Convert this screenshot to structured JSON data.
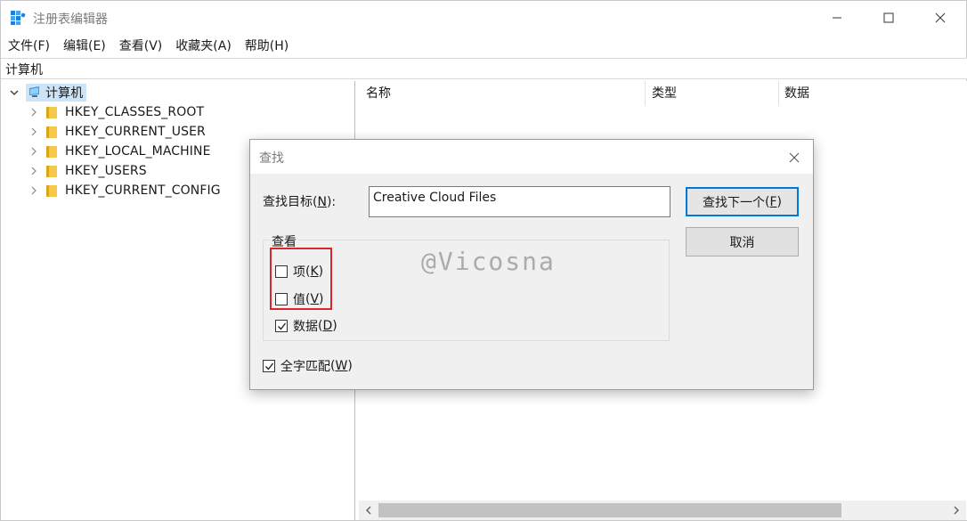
{
  "window": {
    "title": "注册表编辑器",
    "app_icon": "regedit-icon"
  },
  "menu": [
    {
      "label": "文件(F)"
    },
    {
      "label": "编辑(E)"
    },
    {
      "label": "查看(V)"
    },
    {
      "label": "收藏夹(A)"
    },
    {
      "label": "帮助(H)"
    }
  ],
  "address": {
    "path": "计算机"
  },
  "tree": {
    "root": {
      "label": "计算机",
      "icon": "computer-icon"
    },
    "hives": [
      {
        "label": "HKEY_CLASSES_ROOT"
      },
      {
        "label": "HKEY_CURRENT_USER"
      },
      {
        "label": "HKEY_LOCAL_MACHINE"
      },
      {
        "label": "HKEY_USERS"
      },
      {
        "label": "HKEY_CURRENT_CONFIG"
      }
    ]
  },
  "list": {
    "columns": [
      {
        "label": "名称"
      },
      {
        "label": "类型"
      },
      {
        "label": "数据"
      }
    ]
  },
  "find_dialog": {
    "title": "查找",
    "target_label": "查找目标",
    "target_hotkey": "N",
    "target_value": "Creative Cloud Files",
    "find_next_label": "查找下一个",
    "find_next_hotkey": "F",
    "cancel_label": "取消",
    "look_at_label": "查看",
    "options": [
      {
        "label": "项",
        "hotkey": "K",
        "checked": false
      },
      {
        "label": "值",
        "hotkey": "V",
        "checked": false
      },
      {
        "label": "数据",
        "hotkey": "D",
        "checked": true
      }
    ],
    "match_whole": {
      "label": "全字匹配",
      "hotkey": "W",
      "checked": true
    },
    "highlight_color": "#d9262a"
  },
  "watermark": "@Vicosna",
  "colors": {
    "selection": "#cce4f7",
    "accent": "#0078d7",
    "dialog_bg": "#f0f0f0"
  }
}
